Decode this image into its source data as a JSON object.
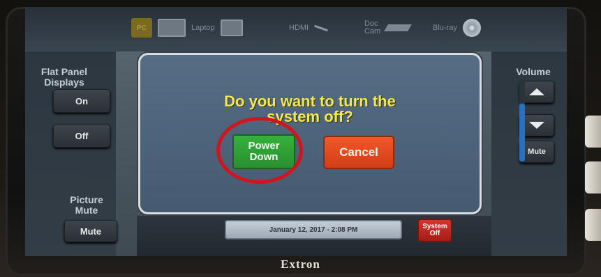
{
  "sources": {
    "pc_label": "PC",
    "laptop_label": "Laptop",
    "hdmi_label": "HDMI",
    "doccam_label": "Doc\nCam",
    "bluray_label": "Blu-ray"
  },
  "left_panel": {
    "flat_panel_label": "Flat Panel\nDisplays",
    "on_label": "On",
    "off_label": "Off",
    "picture_mute_label": "Picture\nMute",
    "mute_label": "Mute"
  },
  "right_panel": {
    "volume_label": "Volume",
    "mute_label": "Mute"
  },
  "dialog": {
    "question": "Do you want to turn the\nsystem off?",
    "power_down_label": "Power\nDown",
    "cancel_label": "Cancel"
  },
  "status": {
    "datetime": "January 12, 2017  -  2:08 PM",
    "system_off_label": "System\nOff"
  },
  "brand": "Extron",
  "colors": {
    "highlight_ring": "#d2141c",
    "power_down": "#2a8f30",
    "cancel": "#d23e16",
    "question_text": "#f4e84a",
    "volume_fill": "#2b6fc0"
  },
  "volume_level": 0.7
}
